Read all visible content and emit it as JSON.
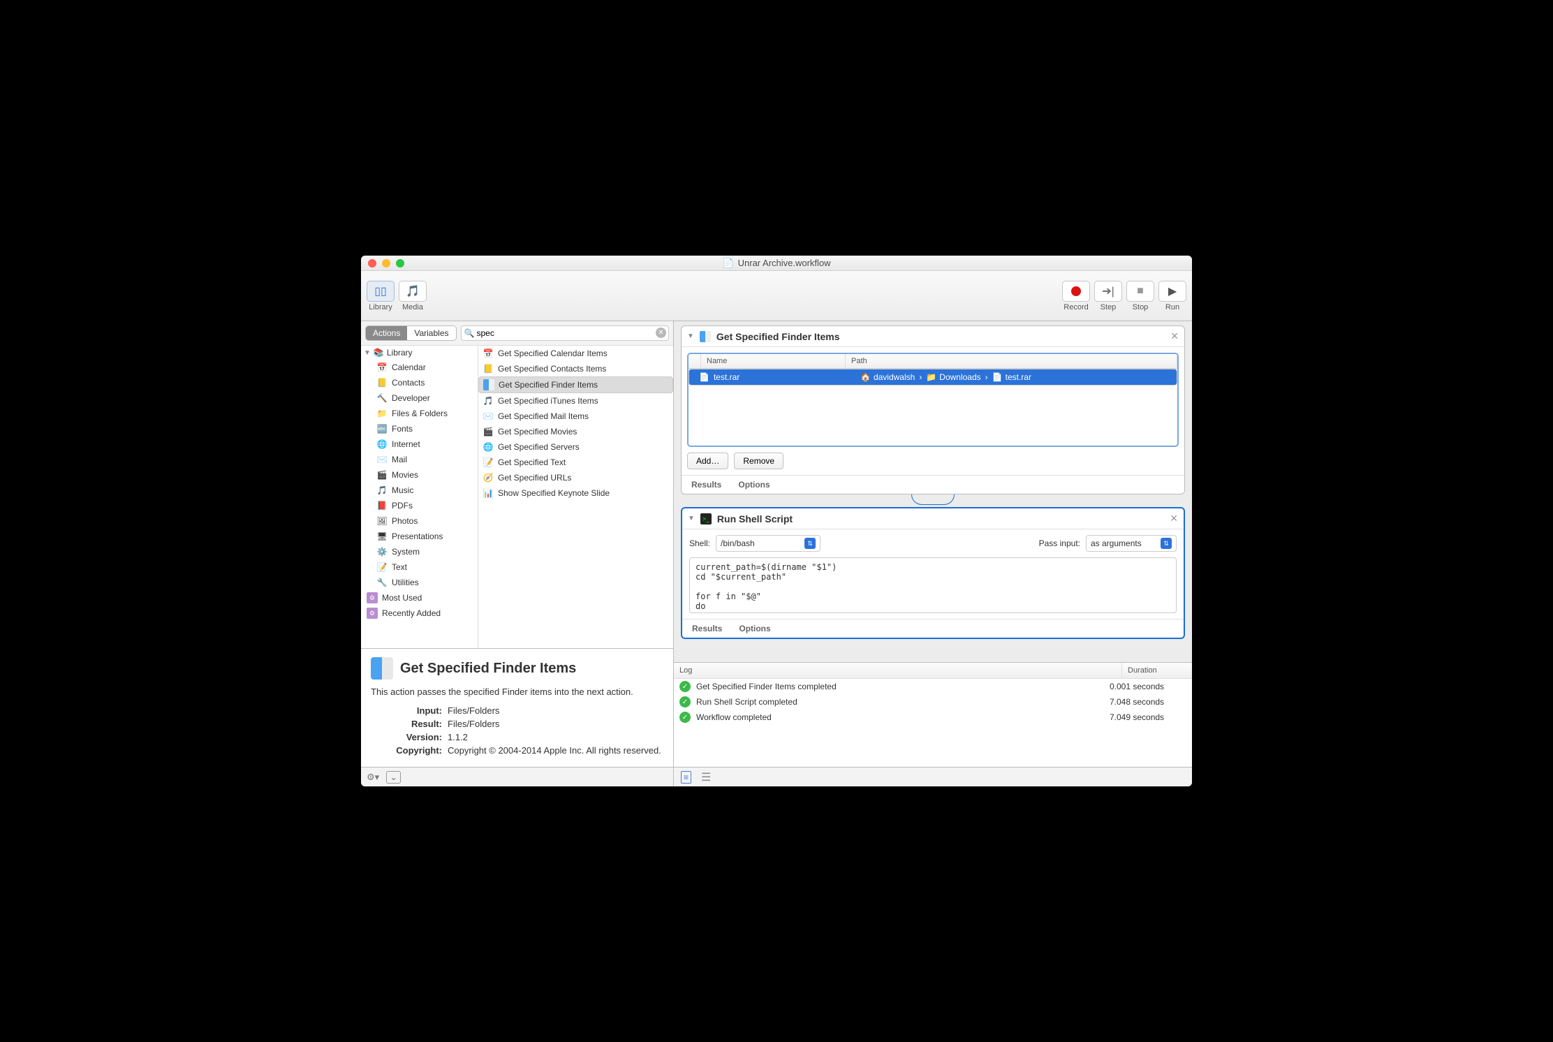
{
  "window_title": "Unrar Archive.workflow",
  "toolbar": {
    "library": "Library",
    "media": "Media",
    "record": "Record",
    "step": "Step",
    "stop": "Stop",
    "run": "Run"
  },
  "tabs": {
    "actions": "Actions",
    "variables": "Variables"
  },
  "search": {
    "placeholder": "",
    "value": "spec"
  },
  "library": {
    "header": "Library",
    "items": [
      "Calendar",
      "Contacts",
      "Developer",
      "Files & Folders",
      "Fonts",
      "Internet",
      "Mail",
      "Movies",
      "Music",
      "PDFs",
      "Photos",
      "Presentations",
      "System",
      "Text",
      "Utilities"
    ],
    "smart": [
      "Most Used",
      "Recently Added"
    ]
  },
  "actions": [
    "Get Specified Calendar Items",
    "Get Specified Contacts Items",
    "Get Specified Finder Items",
    "Get Specified iTunes Items",
    "Get Specified Mail Items",
    "Get Specified Movies",
    "Get Specified Servers",
    "Get Specified Text",
    "Get Specified URLs",
    "Show Specified Keynote Slide"
  ],
  "info": {
    "title": "Get Specified Finder Items",
    "desc": "This action passes the specified Finder items into the next action.",
    "input_label": "Input:",
    "input": "Files/Folders",
    "result_label": "Result:",
    "result": "Files/Folders",
    "version_label": "Version:",
    "version": "1.1.2",
    "copyright_label": "Copyright:",
    "copyright": "Copyright © 2004-2014 Apple Inc.  All rights reserved."
  },
  "wf": {
    "act1": {
      "title": "Get Specified Finder Items",
      "col_name": "Name",
      "col_path": "Path",
      "file": {
        "name": "test.rar",
        "crumbs": [
          "davidwalsh",
          "Downloads",
          "test.rar"
        ]
      },
      "add": "Add…",
      "remove": "Remove",
      "results": "Results",
      "options": "Options"
    },
    "act2": {
      "title": "Run Shell Script",
      "shell_label": "Shell:",
      "shell": "/bin/bash",
      "pass_label": "Pass input:",
      "pass": "as arguments",
      "code": "current_path=$(dirname \"$1\")\ncd \"$current_path\"\n\nfor f in \"$@\"\ndo",
      "results": "Results",
      "options": "Options"
    }
  },
  "log": {
    "col_log": "Log",
    "col_dur": "Duration",
    "rows": [
      {
        "msg": "Get Specified Finder Items completed",
        "dur": "0.001 seconds"
      },
      {
        "msg": "Run Shell Script completed",
        "dur": "7.048 seconds"
      },
      {
        "msg": "Workflow completed",
        "dur": "7.049 seconds"
      }
    ]
  }
}
